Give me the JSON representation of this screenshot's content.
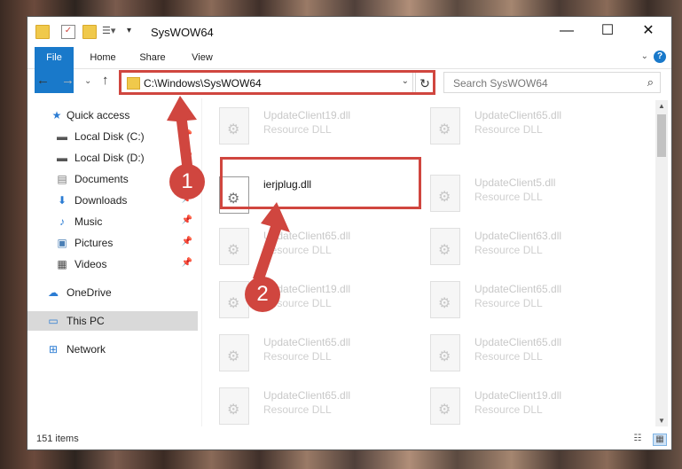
{
  "window": {
    "title": "SysWOW64"
  },
  "ribbon": {
    "tabs": [
      "File",
      "Home",
      "Share",
      "View"
    ]
  },
  "address": {
    "path": "C:\\Windows\\SysWOW64"
  },
  "search": {
    "placeholder": "Search SysWOW64"
  },
  "nav": {
    "items": [
      {
        "label": "Quick access",
        "icon": "star-icon"
      },
      {
        "label": "Local Disk (C:)",
        "icon": "drive-icon",
        "pinned": true
      },
      {
        "label": "Local Disk (D:)",
        "icon": "drive-icon",
        "pinned": true
      },
      {
        "label": "Documents",
        "icon": "documents-icon",
        "pinned": true
      },
      {
        "label": "Downloads",
        "icon": "download-icon",
        "pinned": true
      },
      {
        "label": "Music",
        "icon": "music-icon",
        "pinned": true
      },
      {
        "label": "Pictures",
        "icon": "pictures-icon",
        "pinned": true
      },
      {
        "label": "Videos",
        "icon": "videos-icon",
        "pinned": true
      },
      {
        "label": "OneDrive",
        "icon": "cloud-icon"
      },
      {
        "label": "This PC",
        "icon": "computer-icon",
        "selected": true
      },
      {
        "label": "Network",
        "icon": "network-icon"
      }
    ]
  },
  "files": {
    "left": [
      {
        "name": "UpdateClient19.dll",
        "type": "Resource DLL"
      },
      {
        "name": "ierjplug.dll",
        "type": "",
        "active": true
      },
      {
        "name": "UpdateClient65.dll",
        "type": "Resource DLL"
      },
      {
        "name": "UpdateClient19.dll",
        "type": "Resource DLL"
      },
      {
        "name": "UpdateClient65.dll",
        "type": "Resource DLL"
      },
      {
        "name": "UpdateClient65.dll",
        "type": "Resource DLL"
      }
    ],
    "right": [
      {
        "name": "UpdateClient65.dll",
        "type": "Resource DLL"
      },
      {
        "name": "UpdateClient5.dll",
        "type": "Resource DLL"
      },
      {
        "name": "UpdateClient63.dll",
        "type": "Resource DLL"
      },
      {
        "name": "UpdateClient65.dll",
        "type": "Resource DLL"
      },
      {
        "name": "UpdateClient65.dll",
        "type": "Resource DLL"
      },
      {
        "name": "UpdateClient19.dll",
        "type": "Resource DLL"
      }
    ]
  },
  "status": {
    "count": "151 items"
  },
  "annotations": [
    "1",
    "2"
  ],
  "colors": {
    "highlight": "#d0463f",
    "accent": "#1979ca"
  }
}
